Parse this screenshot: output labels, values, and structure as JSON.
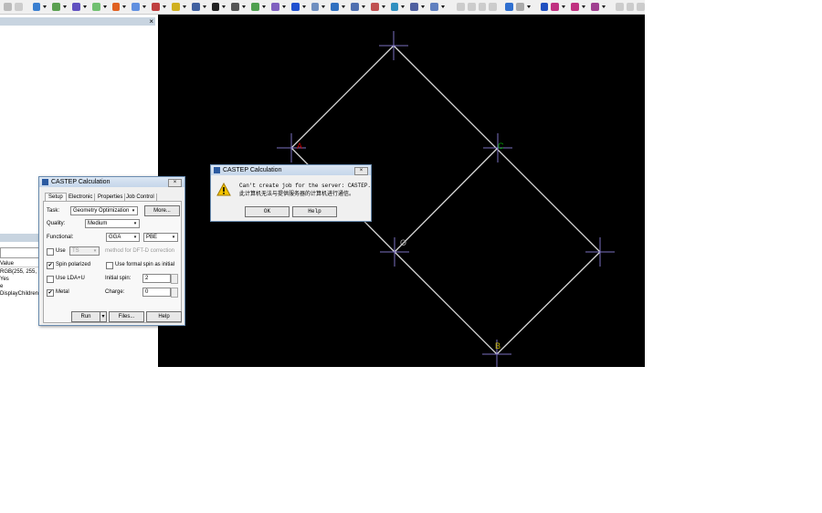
{
  "toolbar": {
    "icons": [
      "toolbar-tool-1",
      "toolbar-tool-2"
    ]
  },
  "left_panel": {
    "close": "×",
    "props_header": "Value",
    "props_values": [
      "RGB(255, 255, 255)",
      "Yes",
      "e",
      "DisplayChildren"
    ]
  },
  "canvas": {
    "atoms": [
      {
        "label": "A",
        "color": "#c00000"
      },
      {
        "label": "C",
        "color": "#00a000"
      },
      {
        "label": "O",
        "color": "#aaaaaa"
      },
      {
        "label": "B",
        "color": "#c0b000"
      }
    ]
  },
  "castep": {
    "title": "CASTEP Calculation",
    "tabs": [
      "Setup",
      "Electronic",
      "Properties",
      "Job Control"
    ],
    "task_label": "Task:",
    "task_value": "Geometry Optimization",
    "more": "More...",
    "quality_label": "Quality:",
    "quality_value": "Medium",
    "functional_label": "Functional:",
    "functional_value": "GGA",
    "functional_sub": "PBE",
    "use_label": "Use",
    "use_value": "TS",
    "dftd_text": "method for DFT-D correction",
    "spin_label": "Spin polarized",
    "formal_spin_label": "Use formal spin as initial",
    "ldau_label": "Use LDA+U",
    "initial_spin_label": "Initial spin:",
    "initial_spin_value": "2",
    "metal_label": "Metal",
    "charge_label": "Charge:",
    "charge_value": "0",
    "run": "Run",
    "files": "Files...",
    "help": "Help",
    "close": "×"
  },
  "error": {
    "title": "CASTEP Calculation",
    "message_line1": "Can't create job for the server: CASTEP.",
    "message_line2": "此计算机无法与提供服务器的计算机进行通信。",
    "ok": "OK",
    "help": "Help",
    "close": "×"
  }
}
